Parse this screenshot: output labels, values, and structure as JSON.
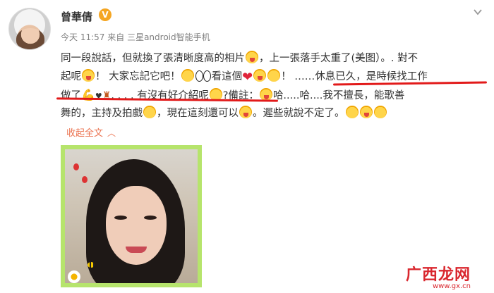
{
  "user": {
    "name": "曾華倩",
    "verified": "V"
  },
  "meta": {
    "time": "今天 11:57",
    "via": "来自",
    "source": "三星android智能手机"
  },
  "post": {
    "line1": [
      "同一段說話，但就換了張清晰度高的相片",
      "，上一張落手太重了(美图）。. 對不"
    ],
    "line2": [
      "起呢",
      "！ 大家忘記它吧！",
      "看這個",
      "！ ……",
      "休息已久，是時候找工作"
    ],
    "line3": [
      "做了",
      "♥",
      ". . . . 有沒有好介紹呢",
      "?備註：",
      "哈.....哈....我不擅長，能歌善"
    ],
    "line4": [
      "舞的，主持及拍戲",
      "，現在這刻還可以",
      "。遲些就說不定了。"
    ]
  },
  "collapse_label": "收起全文",
  "watermark": {
    "text": "广西龙网",
    "domain": "www.gx.cn"
  },
  "icons": {
    "verified": "verified-badge-icon",
    "chevron": "chevron-down-icon",
    "emoji": "emoji-icon"
  },
  "colors": {
    "accent": "#eb7350",
    "underline": "#e21a1a",
    "verified": "#f5a623",
    "frame": "#b6e46c"
  }
}
